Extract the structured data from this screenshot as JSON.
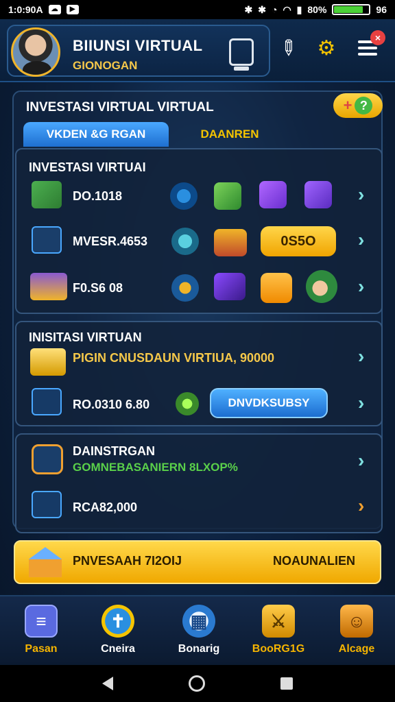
{
  "status_bar": {
    "time": "1:0:90A",
    "battery_percent": "80%",
    "battery_level": 0.8,
    "battery_right": "96"
  },
  "header": {
    "profile_name": "BIIUNSI VIRTUAL",
    "profile_sub": "GIONOGAN",
    "notification_count": "×"
  },
  "main": {
    "title": "INVESTASI VIRTUAL VIRTUAL",
    "badge_plus": "+",
    "badge_q": "?",
    "tabs": [
      {
        "label": "VKDEN &G RGAN"
      },
      {
        "label": "DAANREN"
      }
    ]
  },
  "section1": {
    "title": "INVESTASI VIRTUAI",
    "rows": [
      {
        "label": "DO.1018"
      },
      {
        "label": "MVESR.4653",
        "pill": "0S5O"
      },
      {
        "label": "F0.S6 08"
      }
    ]
  },
  "section2": {
    "title": "INISITASI VIRTUAN",
    "rows": [
      {
        "label": "PIGIN CNUSDAUN VIRTIUA, 90000"
      },
      {
        "label": "RO.0310 6.80",
        "pill": "DNVDKSUBSY"
      }
    ]
  },
  "section3": {
    "rows": [
      {
        "label": "DAINSTRGAN",
        "sub": "GOMNEBASANIERN 8LXOP%"
      },
      {
        "label": "RCA82,000"
      }
    ]
  },
  "cta": {
    "left": "PNVESAAH 7I2OIJ",
    "right": "NOAUNALIEN"
  },
  "nav": [
    {
      "label": "Pasan",
      "icon": "document-icon"
    },
    {
      "label": "Cneira",
      "icon": "plus-shield-icon"
    },
    {
      "label": "Bonarig",
      "icon": "chart-bubble-icon"
    },
    {
      "label": "BooRG1G",
      "icon": "sword-badge-icon"
    },
    {
      "label": "Alcage",
      "icon": "totem-icon"
    }
  ],
  "colors": {
    "accent_gold": "#f5c400",
    "accent_blue": "#1e6fd0",
    "bg_dark": "#0a1f3a"
  }
}
